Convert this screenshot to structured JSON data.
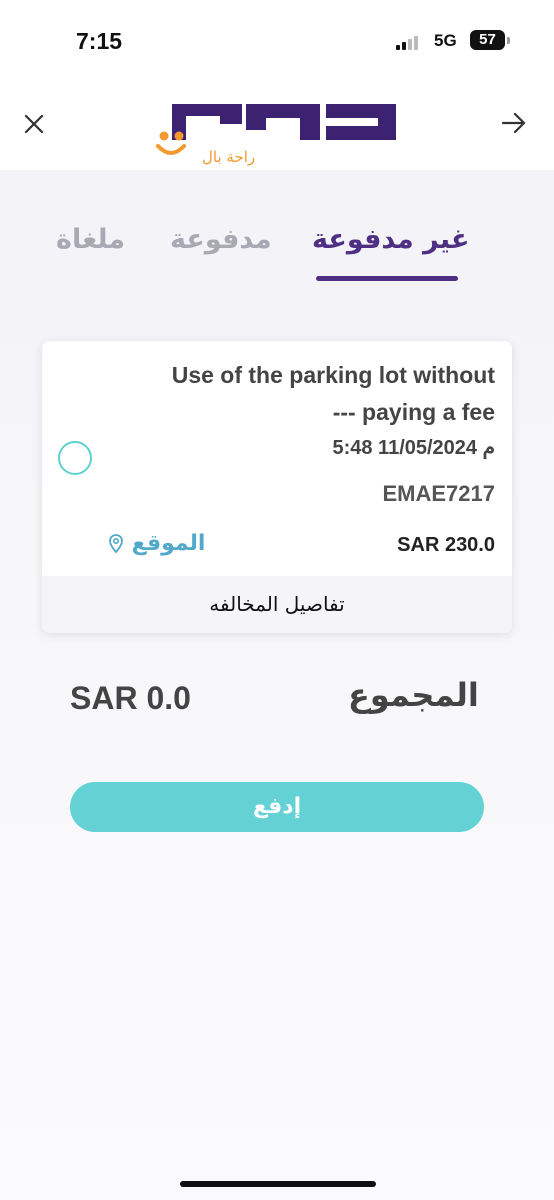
{
  "status_bar": {
    "time": "7:15",
    "network": "5G",
    "battery": "57"
  },
  "header": {
    "close_icon": "close-icon",
    "back_icon": "arrow-right-icon",
    "logo_text": "راحة بال",
    "logo_color": "#3c2270",
    "logo_accent": "#f29a2e"
  },
  "tabs": [
    {
      "label": "غير مدفوعة",
      "active": true
    },
    {
      "label": "مدفوعة",
      "active": false
    },
    {
      "label": "ملغاة",
      "active": false
    }
  ],
  "violation": {
    "title_line1": "Use of the parking lot without",
    "title_line2": "--- paying a fee",
    "datetime": "5:48 11/05/2024 م",
    "code": "EMAE7217",
    "amount": "SAR 230.0",
    "location_label": "الموقع",
    "details_label": "تفاصيل المخالفه",
    "selected": false
  },
  "total": {
    "label": "المجموع",
    "value": "SAR 0.0"
  },
  "pay_button": {
    "label": "إدفع"
  },
  "colors": {
    "primary": "#4e2f83",
    "inactive_tab": "#a9a9b4",
    "teal": "#64d1d5",
    "location": "#52a9cc"
  }
}
